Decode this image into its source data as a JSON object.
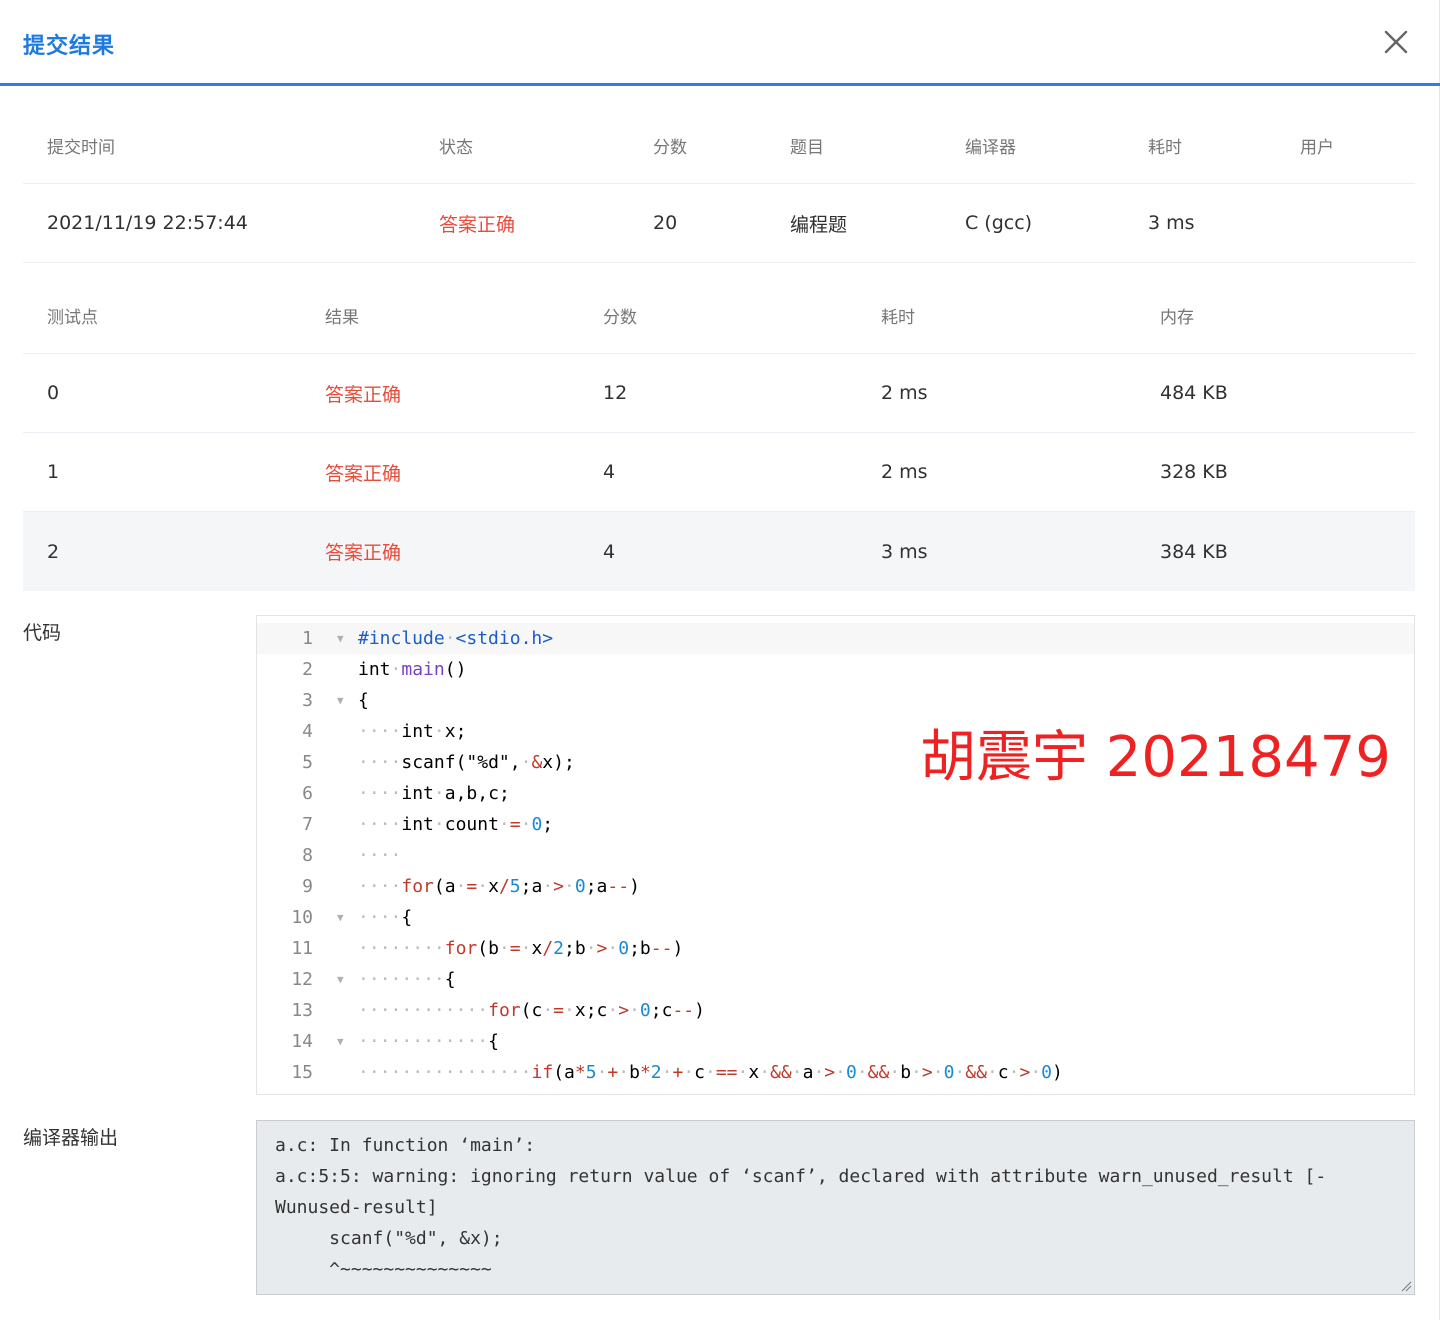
{
  "dialog": {
    "title": "提交结果",
    "close_icon": "close-icon"
  },
  "summary": {
    "headers": [
      "提交时间",
      "状态",
      "分数",
      "题目",
      "编译器",
      "耗时",
      "用户"
    ],
    "row": {
      "time": "2021/11/19 22:57:44",
      "status": "答案正确",
      "score": "20",
      "problem": "编程题",
      "compiler": "C (gcc)",
      "elapsed": "3 ms",
      "user": ""
    }
  },
  "testcases": {
    "headers": [
      "测试点",
      "结果",
      "分数",
      "耗时",
      "内存"
    ],
    "rows": [
      {
        "id": "0",
        "result": "答案正确",
        "score": "12",
        "time": "2 ms",
        "memory": "484 KB"
      },
      {
        "id": "1",
        "result": "答案正确",
        "score": "4",
        "time": "2 ms",
        "memory": "328 KB"
      },
      {
        "id": "2",
        "result": "答案正确",
        "score": "4",
        "time": "3 ms",
        "memory": "384 KB"
      }
    ]
  },
  "code": {
    "label": "代码",
    "lines": [
      {
        "n": "1",
        "fold": true
      },
      {
        "n": "2",
        "fold": false
      },
      {
        "n": "3",
        "fold": true
      },
      {
        "n": "4",
        "fold": false
      },
      {
        "n": "5",
        "fold": false
      },
      {
        "n": "6",
        "fold": false
      },
      {
        "n": "7",
        "fold": false
      },
      {
        "n": "8",
        "fold": false
      },
      {
        "n": "9",
        "fold": false
      },
      {
        "n": "10",
        "fold": true
      },
      {
        "n": "11",
        "fold": false
      },
      {
        "n": "12",
        "fold": true
      },
      {
        "n": "13",
        "fold": false
      },
      {
        "n": "14",
        "fold": true
      },
      {
        "n": "15",
        "fold": false
      }
    ],
    "source": [
      "#include <stdio.h>",
      "int main()",
      "{",
      "    int x;",
      "    scanf(\"%d\", &x);",
      "    int a,b,c;",
      "    int count = 0;",
      "    ",
      "    for(a = x/5;a > 0;a--)",
      "    {",
      "        for(b = x/2;b > 0;b--)",
      "        {",
      "            for(c = x;c > 0;c--)",
      "            {",
      "                if(a*5 + b*2 + c == x && a > 0 && b > 0 && c > 0)"
    ]
  },
  "watermark": "胡震宇 20218479",
  "compiler_output": {
    "label": "编译器输出",
    "lines": [
      "a.c: In function ‘main’:",
      "a.c:5:5: warning: ignoring return value of ‘scanf’, declared with attribute warn_unused_result [-",
      "Wunused-result]",
      "     scanf(\"%d\", &x);",
      "     ^~~~~~~~~~~~~~~"
    ]
  },
  "colors": {
    "accent": "#1f7ae0",
    "accepted": "#e74c3c",
    "watermark": "#ee2222"
  }
}
